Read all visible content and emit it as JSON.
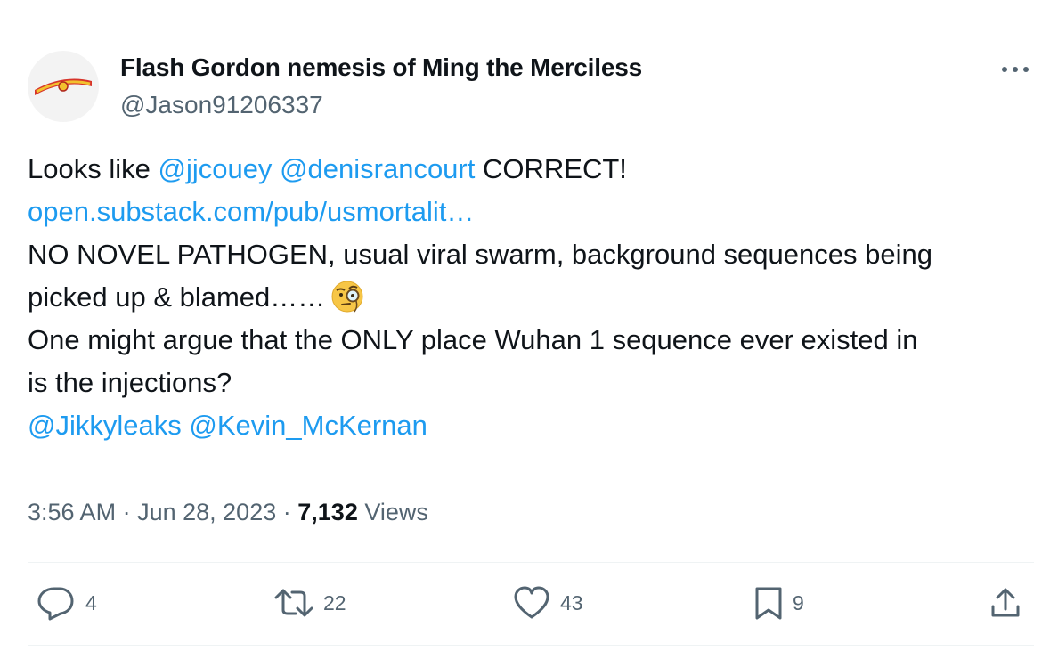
{
  "author": {
    "display_name": "Flash Gordon nemesis of Ming the Merciless",
    "handle": "@Jason91206337"
  },
  "tweet": {
    "line1": {
      "prefix": "Looks like ",
      "mention1": "@jjcouey",
      "mention2": "@denisrancourt",
      "suffix": " CORRECT!"
    },
    "link": "open.substack.com/pub/usmortalit…",
    "line3": "NO NOVEL PATHOGEN, usual viral swarm, background sequences being",
    "line4": "picked up & blamed……",
    "line5": "One might argue that the ONLY place Wuhan 1 sequence ever existed in",
    "line6": "is the injections?",
    "mentions_end": [
      "@Jikkyleaks",
      "@Kevin_McKernan"
    ]
  },
  "meta": {
    "time": "3:56 AM",
    "separator": "·",
    "date": "Jun 28, 2023",
    "views_count": "7,132",
    "views_label": "Views"
  },
  "actions": {
    "replies": "4",
    "retweets": "22",
    "likes": "43",
    "bookmarks": "9"
  },
  "icons": {
    "avatar": "avatar-logo",
    "more": "more-horizontal-icon",
    "emoji": "face-with-monocle-emoji",
    "reply": "reply-icon",
    "retweet": "retweet-icon",
    "like": "heart-icon",
    "bookmark": "bookmark-icon",
    "share": "share-icon"
  },
  "colors": {
    "text": "#0f1419",
    "secondary": "#536471",
    "link": "#1d9bf0",
    "divider": "#eff3f4"
  }
}
